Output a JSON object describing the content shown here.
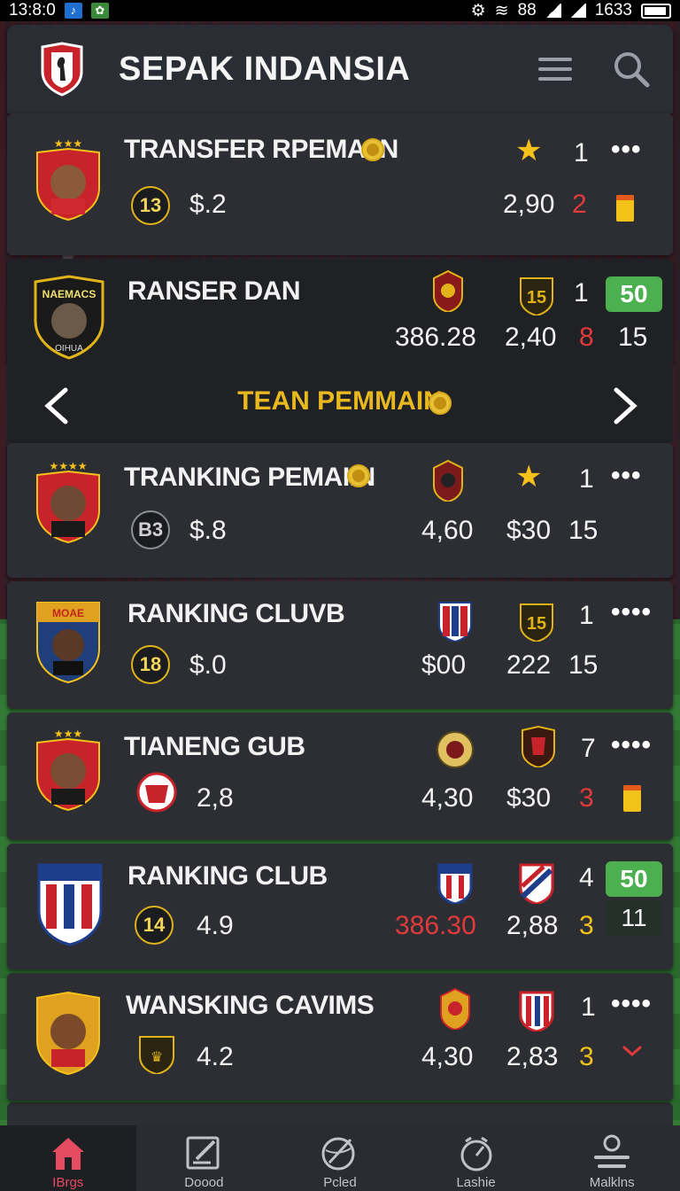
{
  "status_bar": {
    "time": "13:8:0",
    "right_time": "1633",
    "signal": "88"
  },
  "header": {
    "title": "SEPAK INDANSIA"
  },
  "rows": [
    {
      "name": "TRANSFER RPEMAIIN",
      "badge": "13",
      "value": "$.2",
      "stat1": "2,90",
      "stat2": "2",
      "rank": "1"
    },
    {
      "name": "RANSER DAN",
      "amount": "386.28",
      "stat1": "2,40",
      "stat2": "8",
      "rank": "1",
      "tag": "50",
      "tag2": "15",
      "crest_label": "15"
    },
    {
      "name": "TRANKING PEMAIIN",
      "badge": "B3",
      "value": "$.8",
      "amount": "4,60",
      "stat1": "$30",
      "stat2": "15",
      "rank": "1"
    },
    {
      "name": "RANKING CLUVB",
      "badge": "18",
      "value": "$.0",
      "amount": "$00",
      "stat1": "222",
      "stat2": "15",
      "rank": "1",
      "crest_label": "15"
    },
    {
      "name": "TIANENG GUB",
      "value": "2,8",
      "amount": "4,30",
      "stat1": "$30",
      "stat2": "3",
      "rank": "7"
    },
    {
      "name": "RANKING CLUB",
      "badge": "14",
      "value": "4.9",
      "amount": "386.30",
      "stat1": "2,88",
      "stat2": "3",
      "rank": "4",
      "tag": "50",
      "tag2": "11"
    },
    {
      "name": "WANSKING CAVIMS",
      "value": "4.2",
      "amount": "4,30",
      "stat1": "2,83",
      "stat2": "3",
      "rank": "1"
    }
  ],
  "section": {
    "label": "TEAN PEMMAIN"
  },
  "bottom_nav": [
    {
      "label": "IBrgs",
      "icon": "home-icon"
    },
    {
      "label": "Doood",
      "icon": "edit-icon"
    },
    {
      "label": "Pcled",
      "icon": "ball-icon"
    },
    {
      "label": "Lashie",
      "icon": "timer-icon"
    },
    {
      "label": "Malklns",
      "icon": "profile-icon"
    }
  ],
  "colors": {
    "accent": "#e8b81f",
    "red": "#e13a3a",
    "green": "#4caf50",
    "active_nav": "#e54b61"
  }
}
